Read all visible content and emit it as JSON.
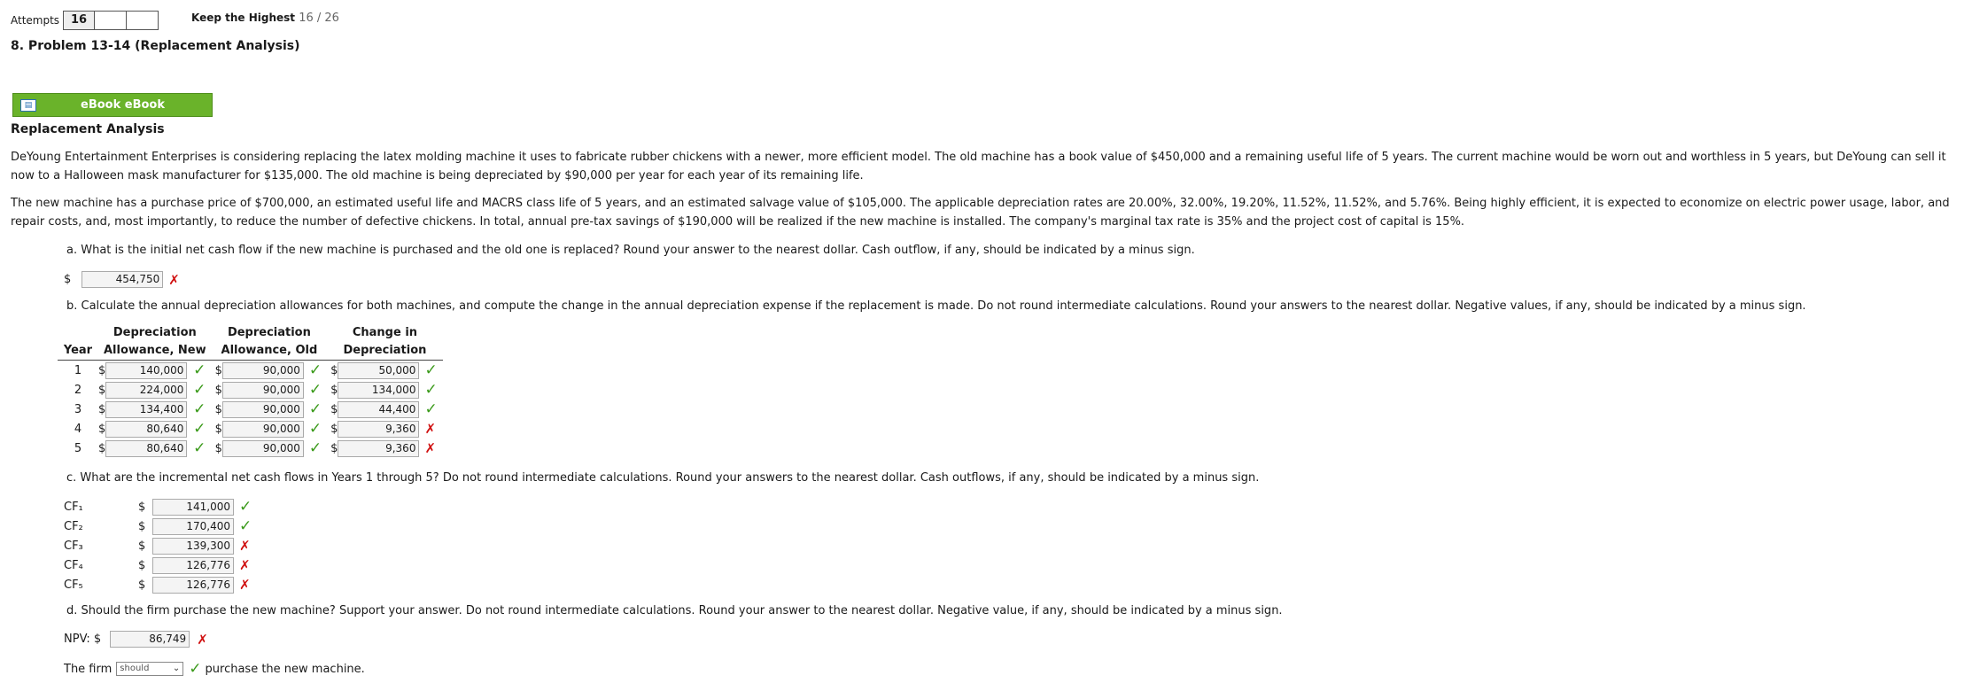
{
  "header": {
    "attempts_label": "Attempts",
    "attempts_value": "16",
    "keep_label": "Keep the Highest",
    "score": "16 / 26"
  },
  "problem_title": "8.  Problem 13-14 (Replacement Analysis)",
  "ebook": {
    "label": "eBook   eBook",
    "icon": "book-icon"
  },
  "section_title": "Replacement Analysis",
  "paragraphs": [
    "DeYoung Entertainment Enterprises is considering replacing the latex molding machine it uses to fabricate rubber chickens with a newer, more efficient model. The old machine has a book value of $450,000 and a remaining useful life of 5 years. The current machine would be worn out and worthless in 5 years, but DeYoung can sell it now to a Halloween mask manufacturer for $135,000. The old machine is being depreciated by $90,000 per year for each year of its remaining life.",
    "The new machine has a purchase price of $700,000, an estimated useful life and MACRS class life of 5 years, and an estimated salvage value of $105,000. The applicable depreciation rates are 20.00%, 32.00%, 19.20%, 11.52%, 11.52%, and 5.76%. Being highly efficient, it is expected to economize on electric power usage, labor, and repair costs, and, most importantly, to reduce the number of defective chickens. In total, annual pre-tax savings of $190,000 will be realized if the new machine is installed. The company's marginal tax rate is 35% and the project cost of capital is 15%."
  ],
  "qa": {
    "text": "a. What is the initial net cash flow if the new machine is purchased and the old one is replaced? Round your answer to the nearest dollar. Cash outflow, if any, should be indicated by a minus sign.",
    "currency": "$",
    "value": "454,750",
    "mark": "✗"
  },
  "qb": {
    "text": "b. Calculate the annual depreciation allowances for both machines, and compute the change in the annual depreciation expense if the replacement is made. Do not round intermediate calculations. Round your answers to the nearest dollar. Negative values, if any, should be indicated by a minus sign.",
    "headers_top": [
      "",
      "Depreciation",
      "Depreciation",
      "Change in"
    ],
    "headers_bottom": [
      "Year",
      "Allowance, New",
      "Allowance, Old",
      "Depreciation"
    ],
    "rows": [
      {
        "year": "1",
        "new": "140,000",
        "new_mark": "✓",
        "old": "90,000",
        "old_mark": "✓",
        "chg": "50,000",
        "chg_mark": "✓"
      },
      {
        "year": "2",
        "new": "224,000",
        "new_mark": "✓",
        "old": "90,000",
        "old_mark": "✓",
        "chg": "134,000",
        "chg_mark": "✓"
      },
      {
        "year": "3",
        "new": "134,400",
        "new_mark": "✓",
        "old": "90,000",
        "old_mark": "✓",
        "chg": "44,400",
        "chg_mark": "✓"
      },
      {
        "year": "4",
        "new": "80,640",
        "new_mark": "✓",
        "old": "90,000",
        "old_mark": "✓",
        "chg": "9,360",
        "chg_mark": "✗"
      },
      {
        "year": "5",
        "new": "80,640",
        "new_mark": "✓",
        "old": "90,000",
        "old_mark": "✓",
        "chg": "9,360",
        "chg_mark": "✗"
      }
    ]
  },
  "qc": {
    "text": "c. What are the incremental net cash flows in Years 1 through 5? Do not round intermediate calculations. Round your answers to the nearest dollar. Cash outflows, if any, should be indicated by a minus sign.",
    "rows": [
      {
        "label": "CF₁",
        "value": "141,000",
        "mark": "✓"
      },
      {
        "label": "CF₂",
        "value": "170,400",
        "mark": "✓"
      },
      {
        "label": "CF₃",
        "value": "139,300",
        "mark": "✗"
      },
      {
        "label": "CF₄",
        "value": "126,776",
        "mark": "✗"
      },
      {
        "label": "CF₅",
        "value": "126,776",
        "mark": "✗"
      }
    ]
  },
  "qd": {
    "text": "d. Should the firm purchase the new machine? Support your answer. Do not round intermediate calculations. Round your answer to the nearest dollar. Negative value, if any, should be indicated by a minus sign.",
    "npv_label": "NPV: $",
    "npv_value": "86,749",
    "npv_mark": "✗",
    "firm_prefix": "The firm",
    "firm_select": "should",
    "firm_mark": "✓",
    "firm_suffix": "purchase the new machine."
  },
  "colors": {
    "check": "#3a9a1a",
    "cross": "#d01010",
    "ebook": "#6ab32a"
  }
}
